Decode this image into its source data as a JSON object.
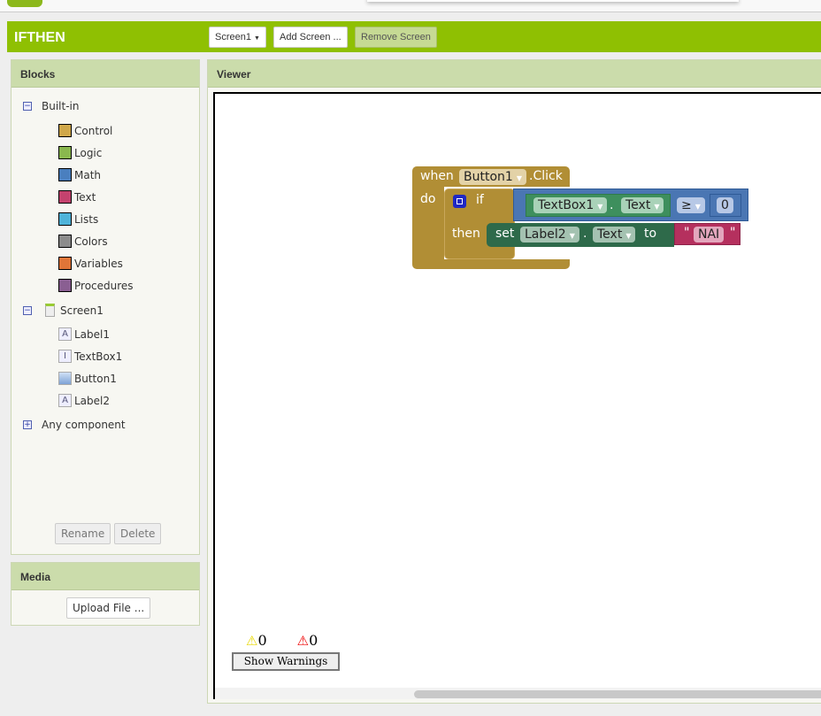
{
  "app": {
    "title": "IFTHEN"
  },
  "toolbar": {
    "screen_select": "Screen1",
    "add_screen": "Add Screen ...",
    "remove_screen": "Remove Screen"
  },
  "blocks_panel": {
    "title": "Blocks",
    "builtin": {
      "label": "Built-in",
      "items": [
        {
          "label": "Control",
          "color": "#d0a84a"
        },
        {
          "label": "Logic",
          "color": "#8ab84e"
        },
        {
          "label": "Math",
          "color": "#4a7fbf"
        },
        {
          "label": "Text",
          "color": "#c4426e"
        },
        {
          "label": "Lists",
          "color": "#4fb3d9"
        },
        {
          "label": "Colors",
          "color": "#8c8c8c"
        },
        {
          "label": "Variables",
          "color": "#e07538"
        },
        {
          "label": "Procedures",
          "color": "#8a5f92"
        }
      ]
    },
    "screen": {
      "label": "Screen1",
      "items": [
        {
          "label": "Label1",
          "icon": "A"
        },
        {
          "label": "TextBox1",
          "icon": "I"
        },
        {
          "label": "Button1",
          "icon": ""
        },
        {
          "label": "Label2",
          "icon": "A"
        }
      ]
    },
    "any_component": "Any component",
    "rename": "Rename",
    "delete": "Delete"
  },
  "media_panel": {
    "title": "Media",
    "upload": "Upload File ..."
  },
  "viewer": {
    "title": "Viewer",
    "blocks": {
      "when": "when",
      "component": "Button1",
      "event": ".Click",
      "do": "do",
      "if": "if",
      "then": "then",
      "textbox": "TextBox1",
      "dot": ".",
      "prop1": "Text",
      "op": "≥",
      "num": "0",
      "set": "set",
      "label": "Label2",
      "prop2": "Text",
      "to": "to",
      "quote": "\"",
      "string": "NAI"
    },
    "warnings": {
      "warning_count": "0",
      "error_count": "0",
      "button": "Show Warnings"
    }
  }
}
